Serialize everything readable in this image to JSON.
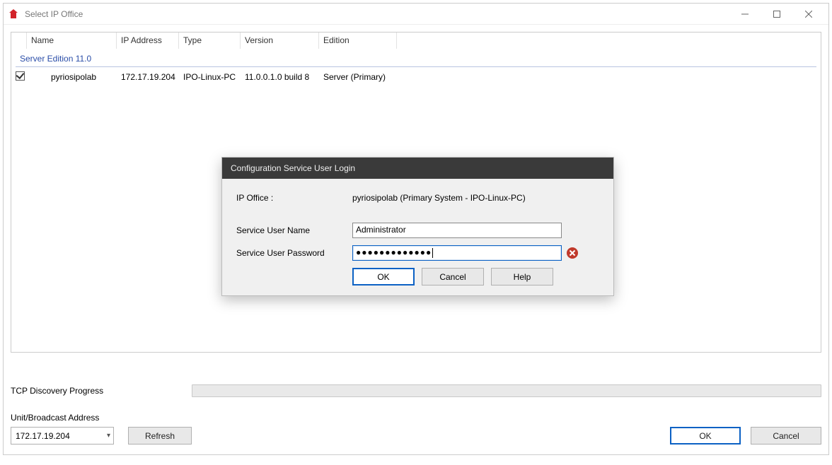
{
  "window": {
    "title": "Select IP Office"
  },
  "columns": {
    "name": "Name",
    "ip": "IP Address",
    "type": "Type",
    "version": "Version",
    "edition": "Edition"
  },
  "group_header": "Server Edition 11.0",
  "row": {
    "checked": true,
    "name": "pyriosipolab",
    "ip": "172.17.19.204",
    "type": "IPO-Linux-PC",
    "version": "11.0.0.1.0 build 8",
    "edition": "Server (Primary)"
  },
  "footer": {
    "progress_label": "TCP Discovery Progress",
    "addr_label": "Unit/Broadcast Address",
    "addr_value": "172.17.19.204",
    "refresh": "Refresh",
    "ok": "OK",
    "cancel": "Cancel"
  },
  "dialog": {
    "title": "Configuration Service User Login",
    "ipoffice_label": "IP Office :",
    "ipoffice_value": "pyriosipolab (Primary System - IPO-Linux-PC)",
    "user_label": "Service User Name",
    "user_value": "Administrator",
    "pw_label": "Service User Password",
    "pw_masked": "●●●●●●●●●●●●●",
    "ok": "OK",
    "cancel": "Cancel",
    "help": "Help"
  }
}
